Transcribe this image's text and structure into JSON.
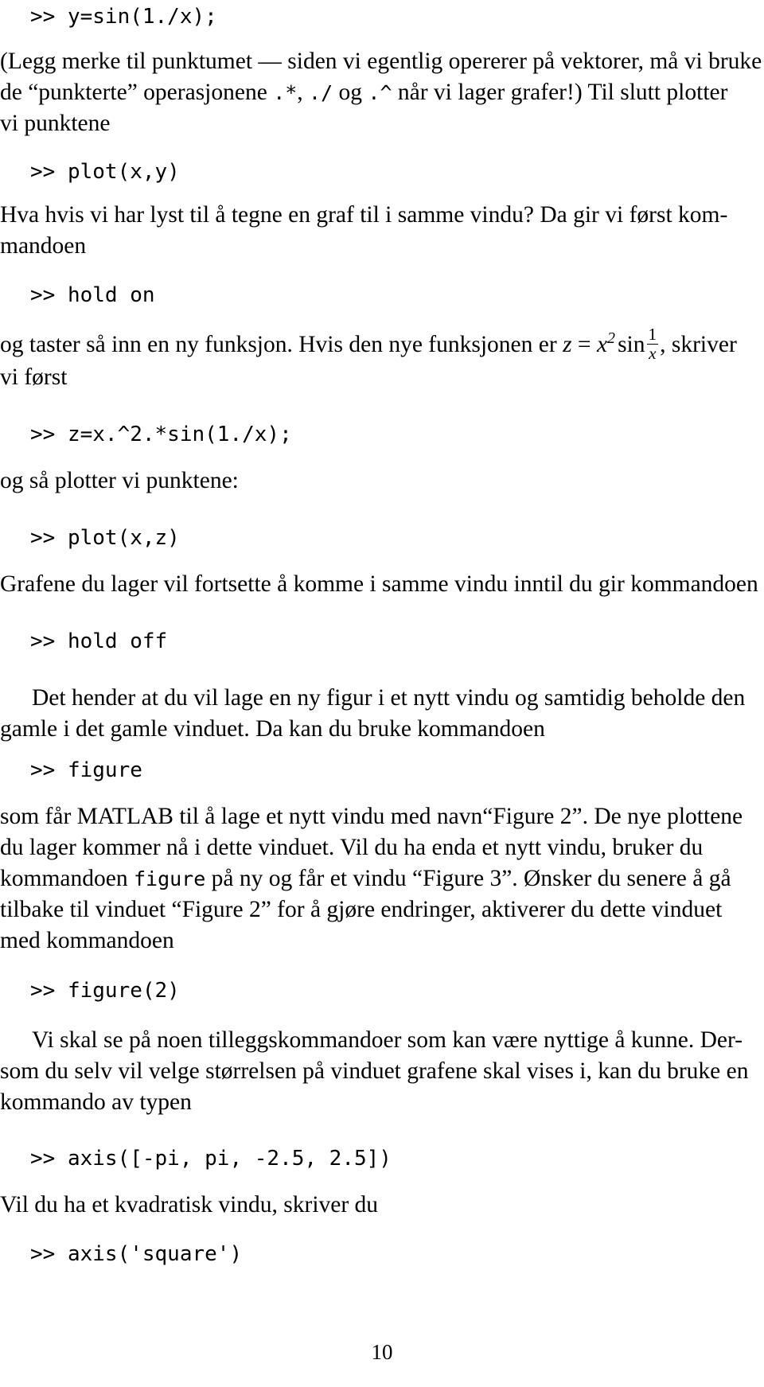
{
  "document": {
    "language": "Norwegian",
    "page_number": "10",
    "blocks": [
      {
        "type": "code",
        "text": ">> y=sin(1./x);"
      },
      {
        "type": "paragraph",
        "id": "p1",
        "text_full": "(Legg merke til punktumet — siden vi egentlig opererer på vektorer, må vi bruke de “punkterte” operasjonene .*, ./ og .^ når vi lager grafer!) Til slutt plotter vi punktene",
        "lines": [
          "(Legg merke til punktumet — siden vi egentlig opererer på vektorer, må vi bruke",
          "de “punkterte” operasjonene .*, ./ og .^ når vi lager grafer!) Til slutt plotter",
          "vi punktene"
        ]
      },
      {
        "type": "code",
        "text": ">> plot(x,y)"
      },
      {
        "type": "paragraph",
        "id": "p2",
        "text_full": "Hva hvis vi har lyst til å tegne en graf til i samme vindu? Da gir vi først kommandoen",
        "lines": [
          "Hva hvis vi har lyst til å tegne en graf til i samme vindu? Da gir vi først kom-",
          "mandoen"
        ]
      },
      {
        "type": "code",
        "text": ">> hold on"
      },
      {
        "type": "paragraph",
        "id": "p3",
        "text_full": "og taster så inn en ny funksjon. Hvis den nye funksjonen er z = x² sin 1/x, skriver vi først",
        "lines": [
          "og taster så inn en ny funksjon. Hvis den nye funksjonen er z = x² sin 1/x, skriver",
          "vi først"
        ],
        "math": {
          "lhs": "z",
          "eq": "=",
          "base": "x",
          "exponent": "2",
          "func": "sin",
          "frac_num": "1",
          "frac_den": "x"
        }
      },
      {
        "type": "code",
        "text": ">> z=x.^2.*sin(1./x);"
      },
      {
        "type": "paragraph",
        "id": "p4",
        "text_full": "og så plotter vi punktene:",
        "lines": [
          "og så plotter vi punktene:"
        ]
      },
      {
        "type": "code",
        "text": ">> plot(x,z)"
      },
      {
        "type": "paragraph",
        "id": "p5",
        "text_full": "Grafene du lager vil fortsette å komme i samme vindu inntil du gir kommandoen",
        "lines": [
          "Grafene du lager vil fortsette å komme i samme vindu inntil du gir kommandoen"
        ]
      },
      {
        "type": "code",
        "text": ">> hold off"
      },
      {
        "type": "paragraph",
        "id": "p6",
        "text_full": "Det hender at du vil lage en ny figur i et nytt vindu og samtidig beholde den gamle i det gamle vinduet. Da kan du bruke kommandoen",
        "lines": [
          "Det hender at du vil lage en ny figur i et nytt vindu og samtidig beholde den",
          "gamle i det gamle vinduet. Da kan du bruke kommandoen"
        ]
      },
      {
        "type": "code",
        "text": ">> figure"
      },
      {
        "type": "paragraph",
        "id": "p7",
        "text_full": "som får MATLAB til å lage et nytt vindu med navn “Figure 2”. De nye plottene du lager kommer nå i dette vinduet. Vil du ha enda et nytt vindu, bruker du kommandoen figure på ny og får et vindu “Figure 3”. Ønsker du senere å gå tilbake til vinduet “Figure 2” for å gjøre endringer, aktiverer du dette vinduet med kommandoen",
        "lines": [
          "som får MATLAB til å lage et nytt vindu med navn“Figure 2”. De nye plottene",
          "du lager kommer nå i dette vinduet. Vil du ha enda et nytt vindu, bruker du",
          "kommandoen figure på ny og får et vindu “Figure 3”. Ønsker du senere å gå",
          "tilbake til vinduet “Figure 2” for å gjøre endringer, aktiverer du dette vinduet",
          "med kommandoen"
        ]
      },
      {
        "type": "code",
        "text": ">> figure(2)"
      },
      {
        "type": "paragraph",
        "id": "p8",
        "text_full": "Vi skal se på noen tilleggskommandoer som kan være nyttige å kunne. Dersom du selv vil velge størrelsen på vinduet grafene skal vises i, kan du bruke en kommando av typen",
        "lines": [
          "Vi skal se på noen tilleggskommandoer som kan være nyttige å kunne. Der-",
          "som du selv vil velge størrelsen på vinduet grafene skal vises i, kan du bruke en",
          "kommando av typen"
        ]
      },
      {
        "type": "code",
        "text": ">> axis([-pi, pi, -2.5, 2.5])"
      },
      {
        "type": "paragraph",
        "id": "p9",
        "text_full": "Vil du ha et kvadratisk vindu, skriver du",
        "lines": [
          "Vil du ha et kvadratisk vindu, skriver du"
        ]
      },
      {
        "type": "code",
        "text": ">> axis('square')"
      }
    ]
  },
  "lines": {
    "code_1": ">> y=sin(1./x);",
    "p1_l1": "(Legg merke til punktumet — siden vi egentlig opererer på vektorer, må vi bruke",
    "p1_l2a": "de “punkterte” operasjonene ",
    "p1_m1": ".*",
    "p1_l2b": ", ",
    "p1_m2": "./",
    "p1_l2c": " og ",
    "p1_m3": ".^",
    "p1_l2d": " når vi lager grafer!) Til slutt plotter",
    "p1_l3": "vi punktene",
    "code_2": ">> plot(x,y)",
    "p2_l1": "Hva hvis vi har lyst til å tegne en graf til i samme vindu? Da gir vi først kom-",
    "p2_l2": "mandoen",
    "code_3": ">> hold on",
    "p3_a": "og taster så inn en ny funksjon. Hvis den nye funksjonen er ",
    "p3_z": "z",
    "p3_eq": " = ",
    "p3_x": "x",
    "p3_exp": "2",
    "p3_sin": "sin",
    "p3_num": "1",
    "p3_den": "x",
    "p3_b": ", skriver",
    "p3_l2": "vi først",
    "code_4": ">> z=x.^2.*sin(1./x);",
    "p4_l1": "og så plotter vi punktene:",
    "code_5": ">> plot(x,z)",
    "p5_l1": "Grafene du lager vil fortsette å komme i samme vindu inntil du gir kommandoen",
    "code_6": ">> hold off",
    "p6_l1": "Det hender at du vil lage en ny figur i et nytt vindu og samtidig beholde den",
    "p6_l2": "gamle i det gamle vinduet. Da kan du bruke kommandoen",
    "code_7": ">> figure",
    "p7_l1": "som får MATLAB til å lage et nytt vindu med navn“Figure 2”. De nye plottene",
    "p7_l2": "du lager kommer nå i dette vinduet. Vil du ha enda et nytt vindu, bruker du",
    "p7_l3a": "kommandoen ",
    "p7_l3m": "figure",
    "p7_l3b": " på ny og får et vindu “Figure 3”. Ønsker du senere å gå",
    "p7_l4": "tilbake til vinduet “Figure 2” for å gjøre endringer, aktiverer du dette vinduet",
    "p7_l5": "med kommandoen",
    "code_8": ">> figure(2)",
    "p8_l1": "Vi skal se på noen tilleggskommandoer som kan være nyttige å kunne. Der-",
    "p8_l2": "som du selv vil velge størrelsen på vinduet grafene skal vises i, kan du bruke en",
    "p8_l3": "kommando av typen",
    "code_9": ">> axis([-pi, pi, -2.5, 2.5])",
    "p9_l1": "Vil du ha et kvadratisk vindu, skriver du",
    "code_10": ">> axis('square')",
    "page_number": "10"
  }
}
